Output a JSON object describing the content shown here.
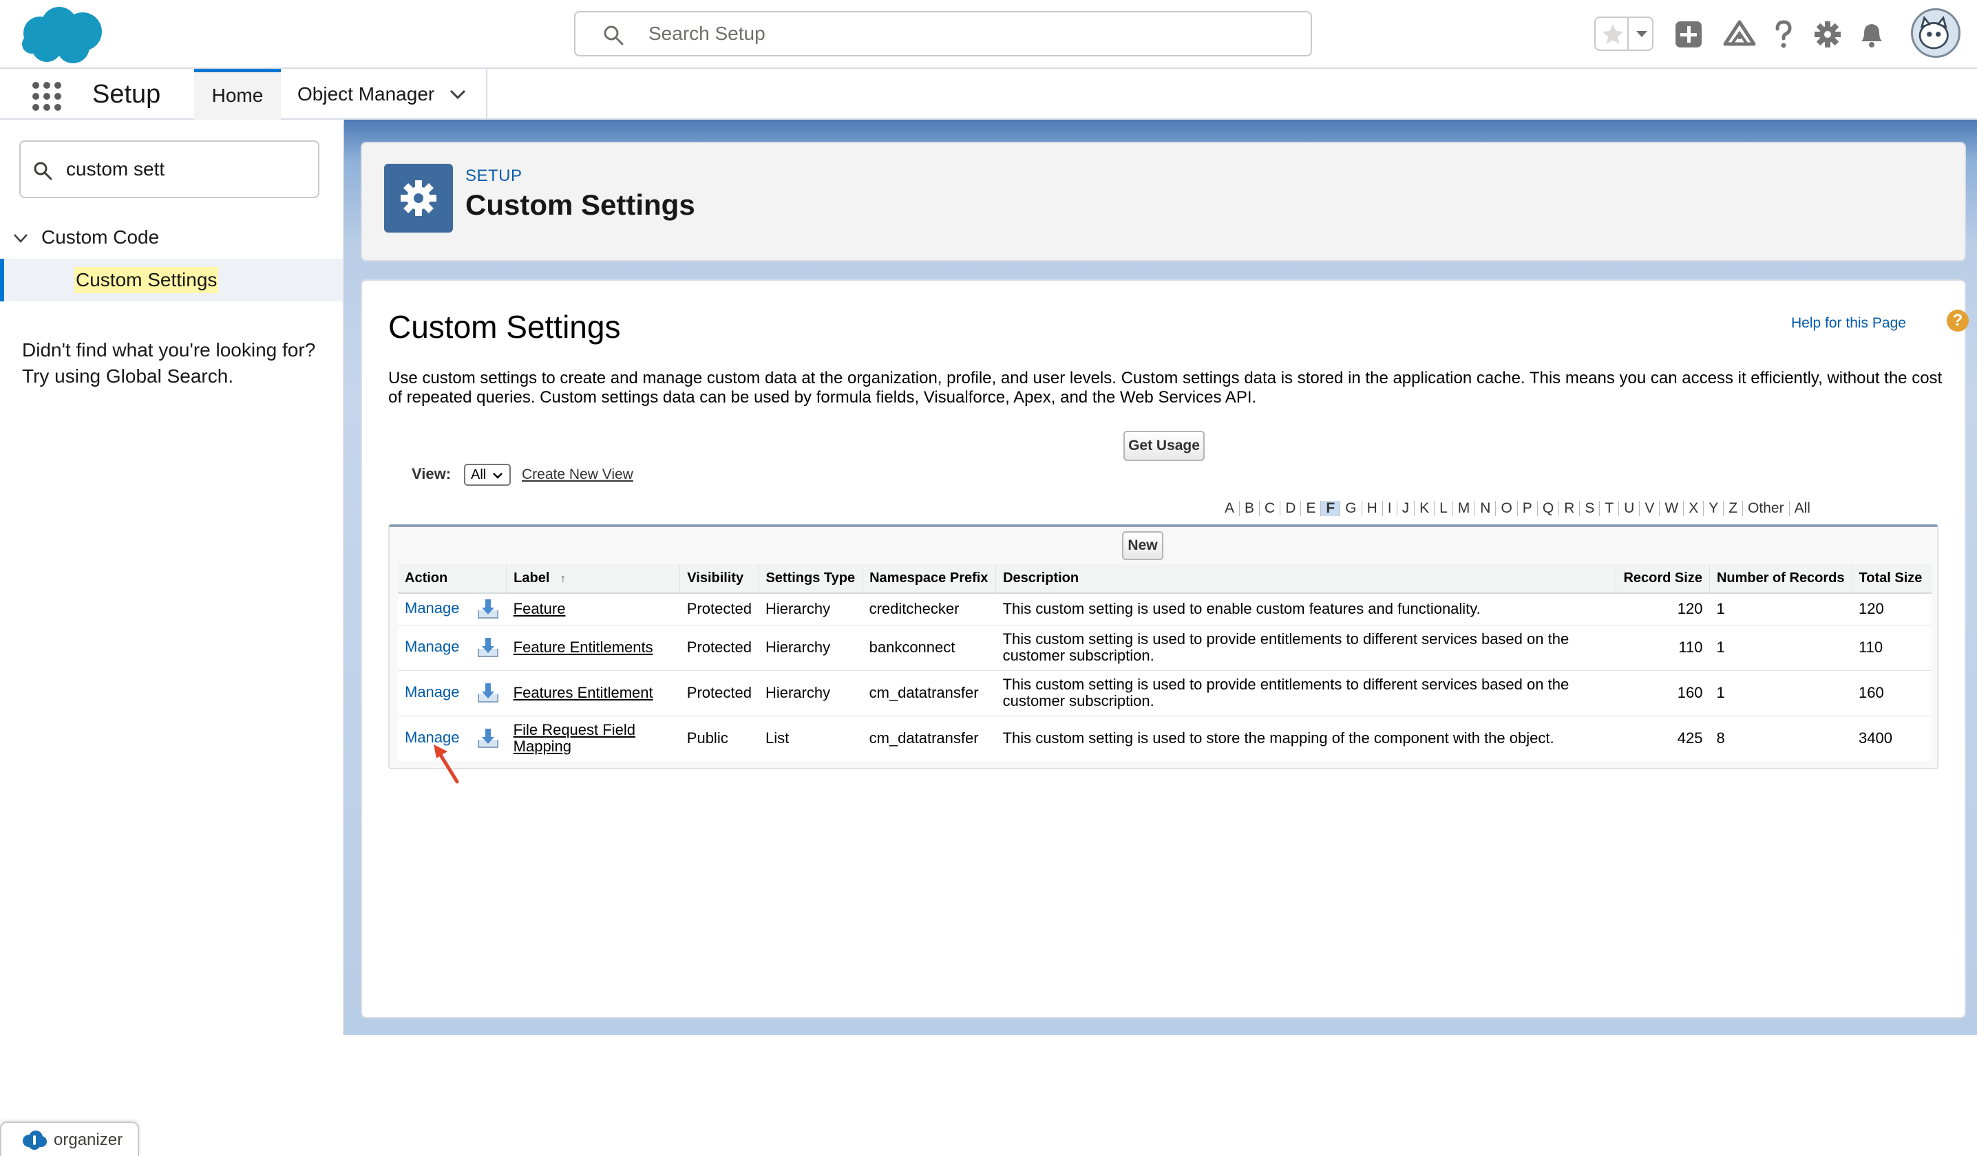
{
  "header": {
    "search_placeholder": "Search Setup",
    "icons": [
      "star-icon",
      "chevron-down-icon",
      "add-icon",
      "trailhead-icon",
      "help-icon",
      "gear-icon",
      "bell-icon",
      "avatar"
    ]
  },
  "nav": {
    "app_name": "Setup",
    "tab_home": "Home",
    "tab_object_manager": "Object Manager"
  },
  "sidebar": {
    "quickfind_value": "custom sett",
    "tree_parent": "Custom Code",
    "tree_child": "Custom Settings",
    "not_found": "Didn't find what you're looking for? Try using Global Search."
  },
  "page_header": {
    "crumb": "SETUP",
    "title": "Custom Settings"
  },
  "content": {
    "heading": "Custom Settings",
    "help_link": "Help for this Page",
    "help_icon_glyph": "?",
    "description": "Use custom settings to create and manage custom data at the organization, profile, and user levels. Custom settings data is stored in the application cache. This means you can access it efficiently, without the cost of repeated queries. Custom settings data can be used by formula fields, Visualforce, Apex, and the Web Services API.",
    "get_usage_button": "Get Usage",
    "view_label": "View:",
    "view_value": "All",
    "create_new_view": "Create New View",
    "new_button": "New",
    "alphabet": [
      "A",
      "B",
      "C",
      "D",
      "E",
      "F",
      "G",
      "H",
      "I",
      "J",
      "K",
      "L",
      "M",
      "N",
      "O",
      "P",
      "Q",
      "R",
      "S",
      "T",
      "U",
      "V",
      "W",
      "X",
      "Y",
      "Z",
      "Other",
      "All"
    ],
    "alphabet_selected": "F"
  },
  "table": {
    "columns": [
      "Action",
      "Label",
      "Visibility",
      "Settings Type",
      "Namespace Prefix",
      "Description",
      "Record Size",
      "Number of Records",
      "Total Size"
    ],
    "sort_indicator": "↑",
    "rows": [
      {
        "action": "Manage",
        "label": "Feature",
        "visibility": "Protected",
        "type": "Hierarchy",
        "ns": "creditchecker",
        "desc": "This custom setting is used to enable custom features and functionality.",
        "record_size": "120",
        "num_records": "1",
        "total": "120"
      },
      {
        "action": "Manage",
        "label": "Feature Entitlements",
        "visibility": "Protected",
        "type": "Hierarchy",
        "ns": "bankconnect",
        "desc": "This custom setting is used to provide entitlements to different services based on the customer subscription.",
        "record_size": "110",
        "num_records": "1",
        "total": "110"
      },
      {
        "action": "Manage",
        "label": "Features Entitlement",
        "visibility": "Protected",
        "type": "Hierarchy",
        "ns": "cm_datatransfer",
        "desc": "This custom setting is used to provide entitlements to different services based on the customer subscription.",
        "record_size": "160",
        "num_records": "1",
        "total": "160"
      },
      {
        "action": "Manage",
        "label": "File Request Field Mapping",
        "visibility": "Public",
        "type": "List",
        "ns": "cm_datatransfer",
        "desc": "This custom setting is used to store the mapping of the component with the object.",
        "record_size": "425",
        "num_records": "8",
        "total": "3400"
      }
    ]
  },
  "organizer": {
    "label": "organizer"
  },
  "colors": {
    "brand_blue": "#0176d3",
    "link": "#015ba7",
    "help_orange": "#e3a033",
    "arrow_red": "#e0442b"
  }
}
